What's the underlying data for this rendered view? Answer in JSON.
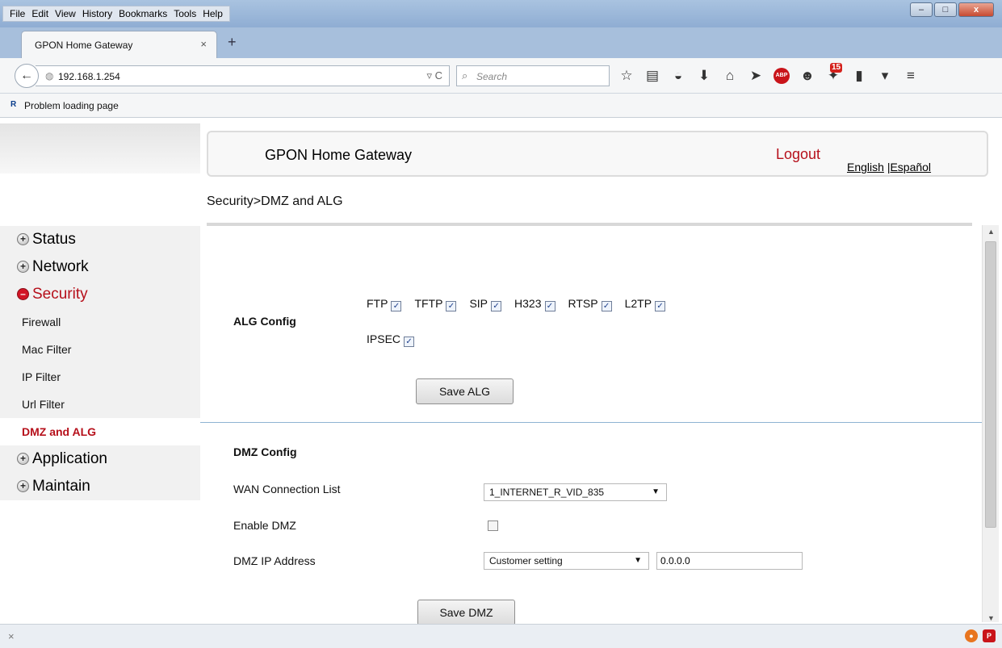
{
  "browser": {
    "menu": [
      "File",
      "Edit",
      "View",
      "History",
      "Bookmarks",
      "Tools",
      "Help"
    ],
    "window_controls": {
      "minimize": "–",
      "maximize": "□",
      "close": "x"
    },
    "tab_title": "GPON Home Gateway",
    "tab_close": "×",
    "new_tab": "+",
    "back": "←",
    "url": "192.168.1.254",
    "reload": "▿ C",
    "search_placeholder": "Search",
    "notification_count": "15",
    "bookmark_label": "Problem loading page",
    "bookmark_icon_text": "R",
    "status_close": "×"
  },
  "header": {
    "title": "GPON Home Gateway",
    "logout": "Logout",
    "lang_en": "English",
    "lang_sep": "|",
    "lang_es": "Español"
  },
  "breadcrumb": "Security>DMZ and ALG",
  "sidebar": {
    "items": [
      {
        "label": "Status"
      },
      {
        "label": "Network"
      },
      {
        "label": "Security"
      },
      {
        "label": "Firewall"
      },
      {
        "label": "Mac Filter"
      },
      {
        "label": "IP Filter"
      },
      {
        "label": "Url Filter"
      },
      {
        "label": "DMZ and ALG"
      },
      {
        "label": "Application"
      },
      {
        "label": "Maintain"
      }
    ]
  },
  "alg": {
    "label": "ALG Config",
    "options": [
      {
        "label": "FTP",
        "checked": true
      },
      {
        "label": "TFTP",
        "checked": true
      },
      {
        "label": "SIP",
        "checked": true
      },
      {
        "label": "H323",
        "checked": true
      },
      {
        "label": "RTSP",
        "checked": true
      },
      {
        "label": "L2TP",
        "checked": true
      },
      {
        "label": "IPSEC",
        "checked": true
      }
    ],
    "save_label": "Save ALG"
  },
  "dmz": {
    "title": "DMZ Config",
    "wan_label": "WAN Connection List",
    "wan_value": "1_INTERNET_R_VID_835",
    "enable_label": "Enable DMZ",
    "enable_checked": false,
    "ip_label": "DMZ IP Address",
    "ip_mode": "Customer setting",
    "ip_value": "0.0.0.0",
    "save_label": "Save DMZ"
  },
  "colors": {
    "accent_red": "#b6101b",
    "sidebar_bg": "#f1f1f1"
  }
}
